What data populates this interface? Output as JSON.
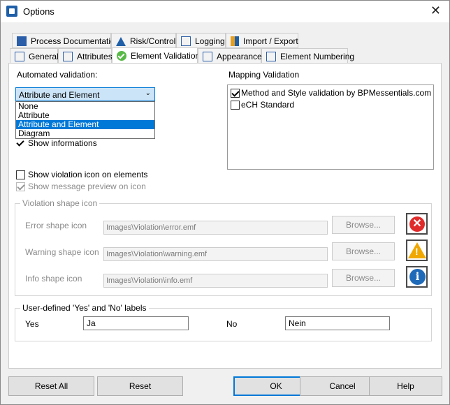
{
  "window": {
    "title": "Options",
    "close_glyph": "✕"
  },
  "tabs_row1": [
    {
      "label": "Process Documentation",
      "icon": "word-doc-icon"
    },
    {
      "label": "Risk/Control",
      "icon": "risk-triangle-icon"
    },
    {
      "label": "Logging",
      "icon": "log-window-icon"
    },
    {
      "label": "Import / Export",
      "icon": "import-export-arrows-icon"
    }
  ],
  "tabs_row2": [
    {
      "label": "General",
      "icon": "general-grid-icon"
    },
    {
      "label": "Attributes",
      "icon": "attributes-list-icon"
    },
    {
      "label": "Element Validation",
      "icon": "validation-check-icon",
      "active": true
    },
    {
      "label": "Appearance",
      "icon": "appearance-image-icon"
    },
    {
      "label": "Element Numbering",
      "icon": "numbering-window-icon"
    }
  ],
  "validation": {
    "label": "Automated validation:",
    "selected": "Attribute and Element",
    "options": [
      "None",
      "Attribute",
      "Attribute and Element",
      "Diagram"
    ],
    "show_informations": "Show informations",
    "show_violation_icon": "Show violation icon on elements",
    "show_message_preview": "Show message preview on icon"
  },
  "mapping": {
    "label": "Mapping Validation",
    "items": [
      {
        "label": "Method and Style validation by BPMessentials.com",
        "checked": true
      },
      {
        "label": "eCH Standard",
        "checked": false
      }
    ]
  },
  "violation": {
    "group_label": "Violation shape icon",
    "browse_label": "Browse...",
    "rows": [
      {
        "label": "Error shape icon",
        "path": "Images\\Violation\\error.emf"
      },
      {
        "label": "Warning shape icon",
        "path": "Images\\Violation\\warning.emf"
      },
      {
        "label": "Info shape icon",
        "path": "Images\\Violation\\info.emf"
      }
    ]
  },
  "yesno": {
    "group_label": "User-defined 'Yes' and 'No' labels",
    "yes_label": "Yes",
    "yes_value": "Ja",
    "no_label": "No",
    "no_value": "Nein"
  },
  "buttons": {
    "reset_all": "Reset All",
    "reset": "Reset",
    "ok": "OK",
    "cancel": "Cancel",
    "help": "Help"
  },
  "colors": {
    "accent": "#0078d7",
    "error": "#e02b2b",
    "warning": "#f0a800",
    "info": "#1f6ab8"
  }
}
